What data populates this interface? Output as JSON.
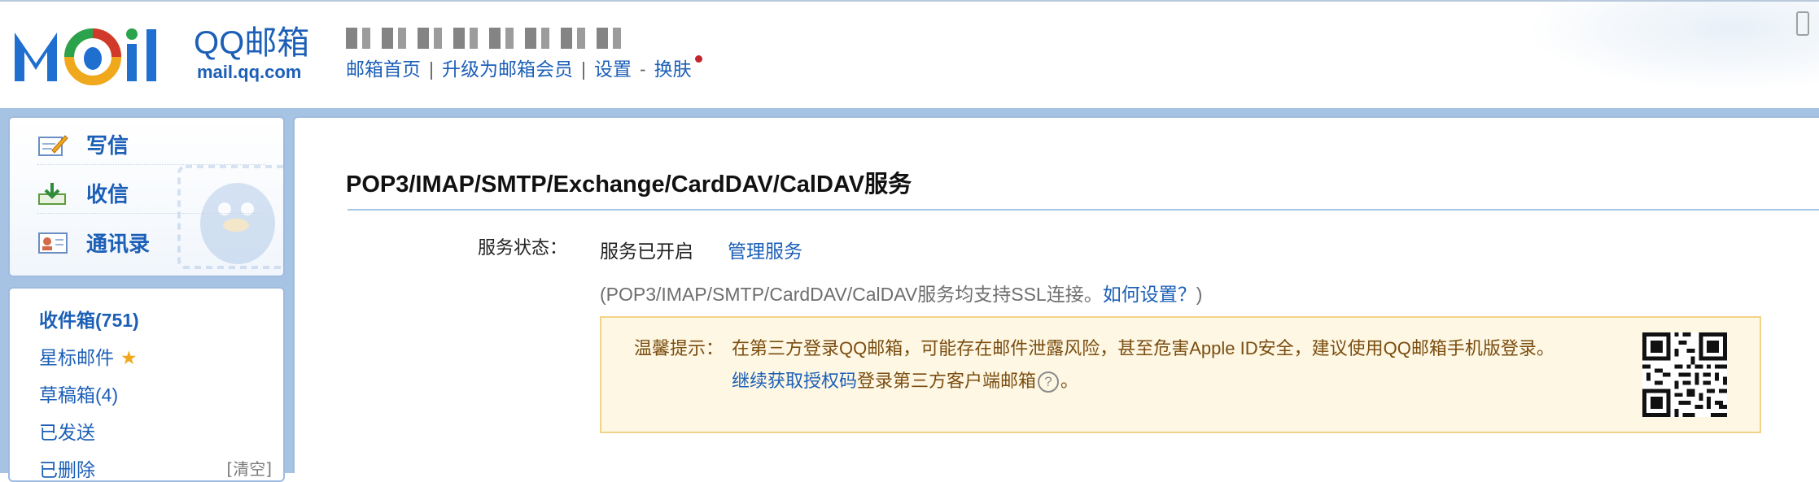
{
  "brand": {
    "logo_text": "MOil",
    "name": "QQ邮箱",
    "domain": "mail.qq.com"
  },
  "topnav": {
    "home": "邮箱首页",
    "sep1": "|",
    "upgrade": "升级为邮箱会员",
    "sep2": "|",
    "settings": "设置",
    "dash": "-",
    "skin": "换肤"
  },
  "quick_actions": {
    "compose": "写信",
    "receive": "收信",
    "contacts": "通讯录"
  },
  "folders": {
    "inbox": "收件箱(751)",
    "starred": "星标邮件",
    "drafts": "草稿箱(4)",
    "sent": "已发送",
    "deleted": "已删除",
    "clear": "[清空]"
  },
  "main": {
    "title": "POP3/IMAP/SMTP/Exchange/CardDAV/CalDAV服务",
    "status_label": "服务状态：",
    "status_value": "服务已开启",
    "manage_link": "管理服务",
    "ssl_note": "(POP3/IMAP/SMTP/CardDAV/CalDAV服务均支持SSL连接。",
    "ssl_link": "如何设置？",
    "ssl_close": ")",
    "tip_label": "温馨提示：",
    "tip_text": "在第三方登录QQ邮箱，可能存在邮件泄露风险，甚至危害Apple ID安全，建议使用QQ邮箱手机版登录。",
    "tip_link": "继续获取授权码",
    "tip_text2": "登录第三方客户端邮箱",
    "tip_end": "。"
  },
  "colors": {
    "brand_blue": "#1c5fb7",
    "band_blue": "#a6c3e4",
    "tip_bg": "#fdf7e3",
    "tip_border": "#f1d488",
    "notify_dot": "#c4242b"
  }
}
